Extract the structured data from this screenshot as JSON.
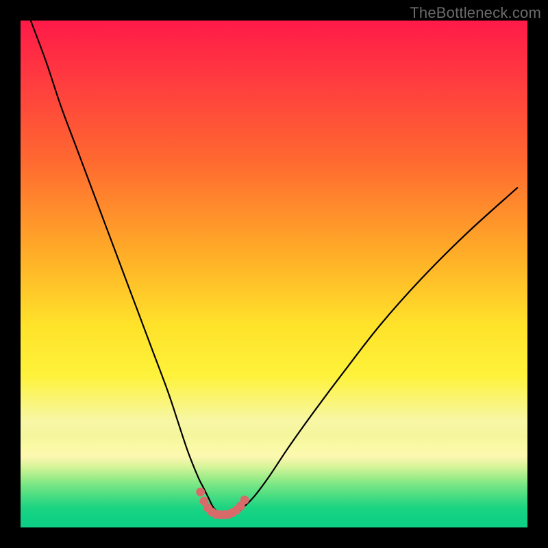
{
  "watermark": "TheBottleneck.com",
  "colors": {
    "page_bg": "#000000",
    "gradient_top": "#ff1a49",
    "gradient_mid": "#ffe22a",
    "gradient_bottom": "#0ecf84",
    "curve_stroke": "#000000",
    "marker_fill": "#d96a6a"
  },
  "chart_data": {
    "type": "line",
    "title": "",
    "xlabel": "",
    "ylabel": "",
    "xlim": [
      0,
      100
    ],
    "ylim": [
      0,
      100
    ],
    "grid": false,
    "legend": null,
    "series": [
      {
        "name": "bottleneck-curve",
        "x": [
          2,
          5,
          8,
          11,
          14,
          17,
          20,
          23,
          26,
          29,
          31,
          33,
          35,
          36,
          37,
          38,
          39,
          40,
          41,
          42,
          43,
          44,
          46,
          49,
          53,
          58,
          64,
          71,
          79,
          88,
          98
        ],
        "y": [
          100,
          92,
          83,
          75,
          67,
          59,
          51,
          43,
          35,
          27,
          21,
          15,
          10,
          8,
          6,
          4,
          3,
          2.5,
          2.5,
          2.5,
          3,
          4,
          6,
          10,
          16,
          23,
          31,
          40,
          49,
          58,
          67
        ]
      }
    ],
    "markers": {
      "name": "trough-markers",
      "x": [
        35.5,
        36.2,
        37.0,
        37.8,
        38.6,
        39.4,
        40.2,
        41.0,
        41.8,
        42.6,
        43.4,
        44.2
      ],
      "y": [
        7.0,
        5.2,
        3.8,
        3.0,
        2.6,
        2.5,
        2.5,
        2.6,
        2.9,
        3.4,
        4.2,
        5.4
      ]
    }
  }
}
